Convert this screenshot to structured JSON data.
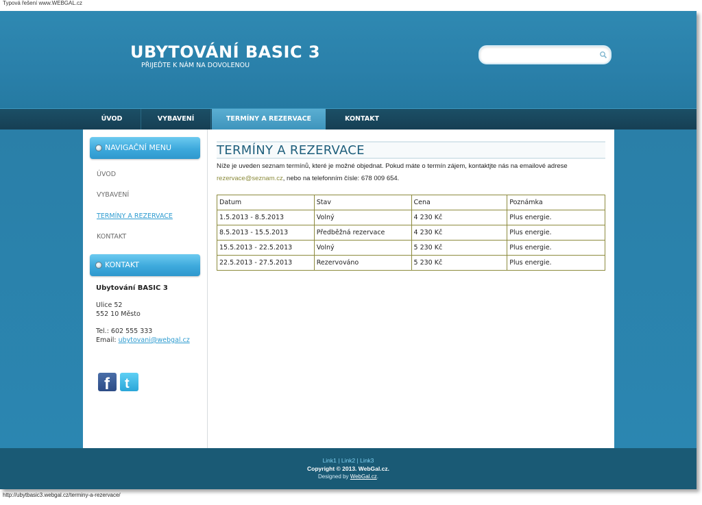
{
  "top_note": "Typová řešení www.WEBGAL.cz",
  "header": {
    "title": "UBYTOVÁNÍ BASIC 3",
    "subtitle": "PŘIJEĎTE K NÁM NA DOVOLENOU",
    "search_value": ""
  },
  "nav": {
    "items": [
      {
        "label": "ÚVOD"
      },
      {
        "label": "VYBAVENÍ"
      },
      {
        "label": "TERMÍNY A REZERVACE"
      },
      {
        "label": "KONTAKT"
      }
    ],
    "active_index": 2
  },
  "sidebar": {
    "menu_title": "NAVIGAČNÍ MENU",
    "links": [
      {
        "label": "ÚVOD"
      },
      {
        "label": "VYBAVENÍ"
      },
      {
        "label": "TERMÍNY A REZERVACE"
      },
      {
        "label": "KONTAKT"
      }
    ],
    "contact_title": "KONTAKT",
    "contact": {
      "name": "Ubytování BASIC 3",
      "street": "Ulice 52",
      "city": "552 10 Město",
      "phone": "Tel.: 602 555 333",
      "email_label": "Email: ",
      "email": "ubytovani@webgal.cz"
    },
    "social": [
      "facebook-icon",
      "twitter-icon"
    ]
  },
  "main": {
    "title": "TERMÍNY A REZERVACE",
    "intro_part1": "Níže je uveden seznam termínů, které je možné objednat. Pokud máte o termín zájem, kontaktjte nás na emailové adrese ",
    "intro_email": "rezervace@seznam.cz",
    "intro_part2": ", nebo na telefonním čísle: 678 009 654.",
    "table": {
      "headers": [
        "Datum",
        "Stav",
        "Cena",
        "Poznámka"
      ],
      "rows": [
        [
          "1.5.2013 - 8.5.2013",
          "Volný",
          "4 230 Kč",
          "Plus energie."
        ],
        [
          "8.5.2013 - 15.5.2013",
          "Předběžná rezervace",
          "4 230 Kč",
          "Plus energie."
        ],
        [
          "15.5.2013 - 22.5.2013",
          "Volný",
          "5 230 Kč",
          "Plus energie."
        ],
        [
          "22.5.2013 - 27.5.2013",
          "Rezervováno",
          "5 230 Kč",
          "Plus energie."
        ]
      ]
    }
  },
  "footer": {
    "links": [
      "Link1",
      "Link2",
      "Link3"
    ],
    "copyright": "Copyright © 2013. WebGal.cz.",
    "designed_prefix": "Designed by ",
    "designed_link": "WebGal.cz",
    "designed_suffix": "."
  },
  "status_url": "http://ubytbasic3.webgal.cz/terminy-a-rezervace/",
  "colors": {
    "header_blue": "#2f89b2",
    "nav_dark": "#1b4f66",
    "nav_active": "#5aaed2",
    "box_head": "#3da9dc",
    "link_blue": "#2d9bd0",
    "table_border": "#8c8a3c",
    "footer": "#1a5a75"
  }
}
